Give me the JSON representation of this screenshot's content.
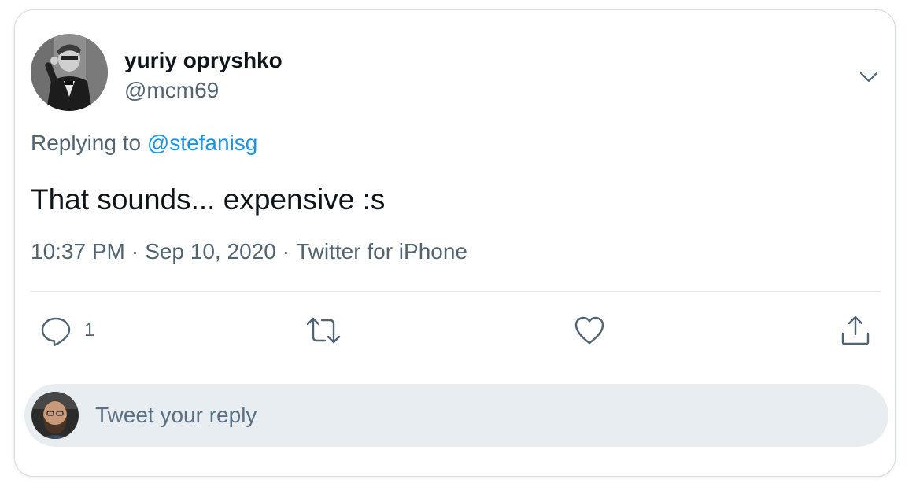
{
  "author": {
    "name": "yuriy opryshko",
    "handle": "@mcm69",
    "avatar_icon": "profile-photo-man-in-tuxedo"
  },
  "reply_context": {
    "prefix": "Replying to",
    "mention": "@stefanisg"
  },
  "tweet": {
    "text": "That sounds... expensive :s",
    "time": "10:37 PM",
    "date": "Sep 10, 2020",
    "source": "Twitter for iPhone",
    "separator": "·"
  },
  "actions": {
    "reply": {
      "icon": "comment-icon",
      "count": "1"
    },
    "retweet": {
      "icon": "retweet-icon"
    },
    "like": {
      "icon": "heart-icon"
    },
    "share": {
      "icon": "share-icon"
    }
  },
  "compose": {
    "placeholder": "Tweet your reply",
    "avatar_icon": "profile-photo-bearded-man"
  },
  "colors": {
    "text": "#0f1419",
    "secondary": "#536471",
    "link": "#1b95e0",
    "reply_bar": "#e8edf1",
    "border": "#d6dce1"
  }
}
